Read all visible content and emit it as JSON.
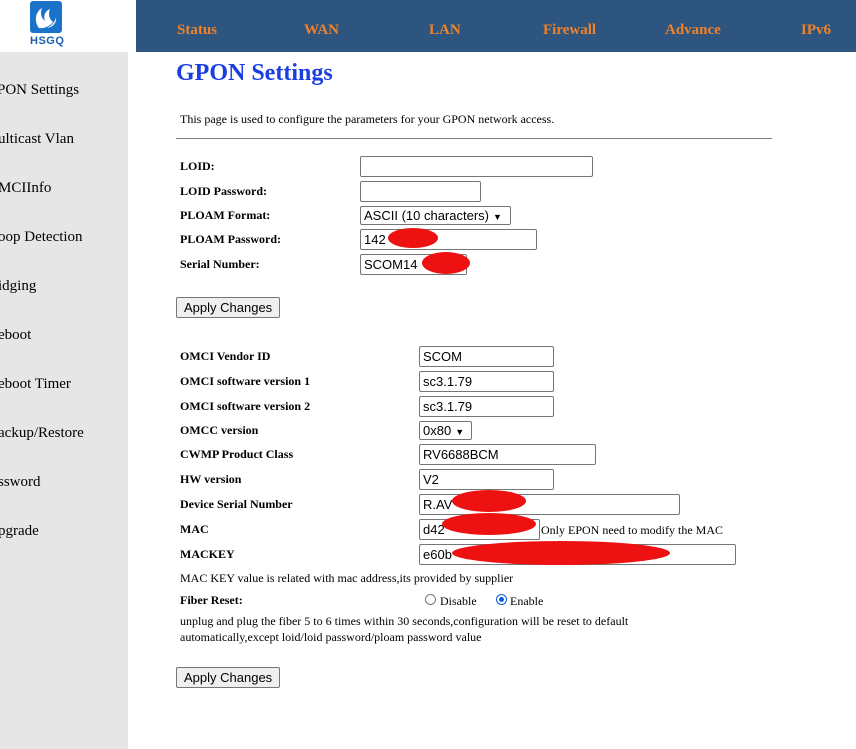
{
  "brand": {
    "name": "HSGQ"
  },
  "nav": [
    "Status",
    "WAN",
    "LAN",
    "Firewall",
    "Advance",
    "IPv6"
  ],
  "sidebar": [
    "PON Settings",
    "ulticast Vlan",
    "MCIInfo",
    "oop Detection",
    "idging",
    "eboot",
    "eboot Timer",
    "ackup/Restore",
    "ssword",
    "pgrade"
  ],
  "page": {
    "title": "GPON Settings",
    "description": "This page is used to configure the parameters for your GPON network access."
  },
  "gpon": {
    "loid_label": "LOID:",
    "loid_value": "",
    "loid_password_label": "LOID Password:",
    "loid_password_value": "",
    "ploam_format_label": "PLOAM Format:",
    "ploam_format_value": "ASCII (10 characters)",
    "ploam_password_label": "PLOAM Password:",
    "ploam_password_value": "142",
    "serial_label": "Serial Number:",
    "serial_value": "SCOM14",
    "apply_label": "Apply Changes"
  },
  "omci": {
    "vendor_label": "OMCI Vendor ID",
    "vendor_value": "SCOM",
    "sw1_label": "OMCI software version 1",
    "sw1_value": "sc3.1.79",
    "sw2_label": "OMCI software version 2",
    "sw2_value": "sc3.1.79",
    "omcc_label": "OMCC version",
    "omcc_value": "0x80",
    "cwmp_label": "CWMP Product Class",
    "cwmp_value": "RV6688BCM",
    "hw_label": "HW version",
    "hw_value": "V2",
    "dsn_label": "Device Serial Number",
    "dsn_value": "R.AV",
    "mac_label": "MAC",
    "mac_value": "d42",
    "mac_note": "Only EPON need to modify the MAC",
    "mackey_label": "MACKEY",
    "mackey_value": "e60b",
    "mackey_note": "MAC KEY value is related with mac address,its provided by supplier",
    "fiber_label": "Fiber Reset:",
    "fiber_disable": "Disable",
    "fiber_enable": "Enable",
    "fiber_selected": "Enable",
    "fiber_note_1": "unplug and plug the fiber 5 to 6 times within 30 seconds,configuration will be reset to default",
    "fiber_note_2": "automatically,except loid/loid password/ploam password value",
    "apply_label": "Apply Changes"
  },
  "colors": {
    "nav_bg": "#2d557f",
    "nav_text": "#f0822a",
    "title": "#1a3fe0",
    "sidebar_bg": "#e6e6e6",
    "redaction": "#ee1111"
  }
}
